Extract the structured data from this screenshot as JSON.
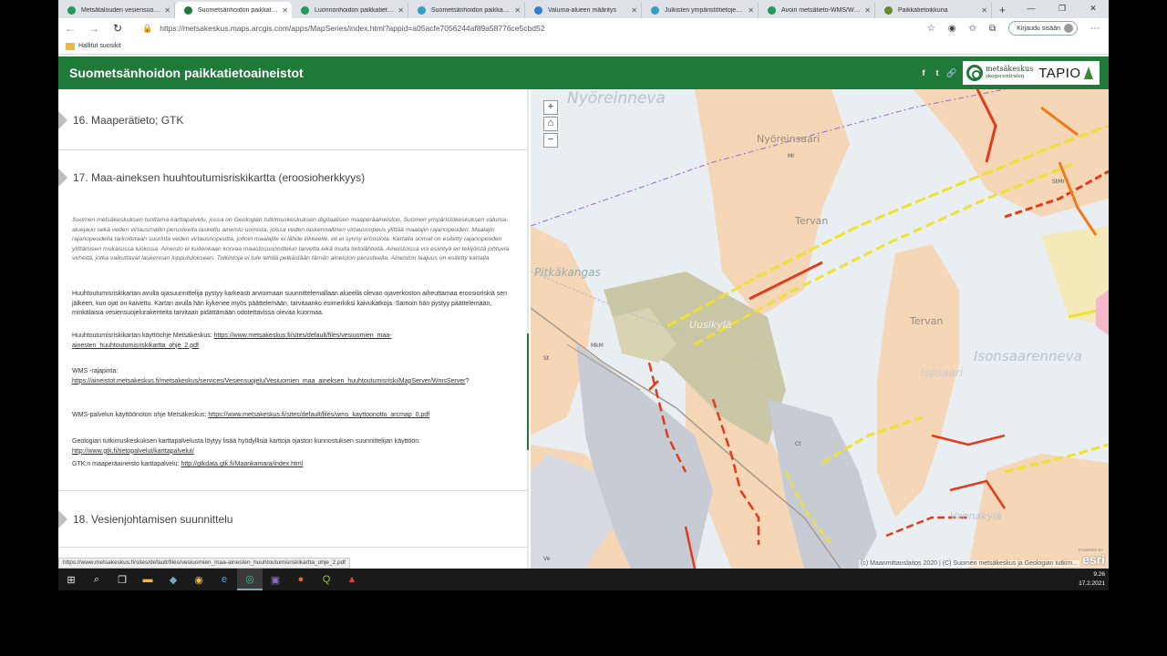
{
  "browser": {
    "tabs": [
      {
        "title": "Metsätalouden vesiensuojelu",
        "color": "#1f9a5a",
        "active": false
      },
      {
        "title": "Suometsänhoidon paikkatietoaineistot",
        "color": "#1f7a3a",
        "active": true
      },
      {
        "title": "Luonnonhoidon paikkatietoaineistot",
        "color": "#1f9a5a",
        "active": false
      },
      {
        "title": "Suometsänhoidon paikkatietoaineistot",
        "color": "#2fa0c0",
        "active": false
      },
      {
        "title": "Valuma-alueen määritys",
        "color": "#2f80d0",
        "active": false
      },
      {
        "title": "Julkisten ympäristötietojen palvelut",
        "color": "#2fa0c0",
        "active": false
      },
      {
        "title": "Avoin metsätieto-WMS/WFS",
        "color": "#1f9a5a",
        "active": false
      },
      {
        "title": "Paikkatietoikkuna",
        "color": "#6a8a2a",
        "active": false
      }
    ],
    "new_tab": "+",
    "window_controls": {
      "minimize": "—",
      "maximize": "❐",
      "close": "✕"
    },
    "url": "https://metsakeskus.maps.arcgis.com/apps/MapSeries/index.html?appid=a05acfe7056244af89a58776ce5cbd52",
    "signin_label": "Kirjaudu sisään",
    "bookmark_folder": "Hallitut suosikit"
  },
  "app": {
    "title": "Suometsänhoidon paikkatietoaineistot",
    "brand_color": "#1f7a3a",
    "social": [
      "f",
      "t",
      "🔗"
    ],
    "logo_metsakeskus": "metsäkeskus",
    "logo_metsakeskus_sub": "skogscentralen",
    "logo_tapio": "TAPIO"
  },
  "panel": {
    "section16": "16. Maaperätieto; GTK",
    "section17": "17. Maa-aineksen huuhtoutumisriskikartta (eroosioherkkyys)",
    "section18": "18. Vesienjohtamisen suunnittelu",
    "intro": "Suomen metsäkeskuksen tuottama karttapalvelu, jossa on Geologian tutkimuskeskuksen digitaalisen maaperäaineiston, Suomen ympäristökeskuksen valuma-aluejaon sekä veden virtausmallin perusteella laskettu aineisto uomista, joissa veden laskennallinen virtausnopeus ylittää maalajin rajanopeuden. Maalajin rajanopeudella tarkoitetaan suurinta veden virtausnopeutta, jolloin maalajite ei lähde liikkeelle, eli ei synny eroosiota. Kartalla uomat on esitetty rajanopeuden ylittämisen mukaisissa luokissa. Aineisto ei kuitenkaan korvaa maastosuunnittelun tarvetta eikä muita tietolähteitä. Aineistoissa voi esiintyä eri tekijöistä johtuvia virheitä, jotka vaikuttavat laskennan lopputulokseen. Tulkintoja ei tule tehdä pelkästään tämän aineiston perusteella. Aineiston laajuus on esitetty kartalla",
    "p1": "Huuhtoutumisriskikartan avulla ojasuunnittelija pystyy karkeasti arvioimaan suunnittelemallaan alueella olevan ojaverkoston aiheuttamaa eroosioriskiä sen jälkeen, kun ojat on kaivettu. Kartan avulla hän kykenee myös päättelemään, tarvitaanko esimerkiksi kaivukatkoja. Samoin hän pystyy päättelemään, minkälaisia vesiensuojelurakenteita tarvitaan pidättämään odotettavissa olevaa kuormaa.",
    "p2_label": "Huuhtoutumisriskikartan käyttöohje Metsäkeskus: ",
    "p2_link": "https://www.metsakeskus.fi/sites/default/files/vesiuomien_maa-ainesten_huuhtoutumisriskikartta_ohje_2.pdf",
    "p3_label": "WMS -rajapinta:",
    "p3_link": "https://aineistot.metsakeskus.fi/metsakeskus/services/Vesiensuojelu/Vesiuomien_maa_aineksen_huuhtoutumisriski/MapServer/WmsServer",
    "p3_suffix": "?",
    "p4_label": "WMS-palvelun käyttöönoton ohje Metsäkeskus: ",
    "p4_link": "https://www.metsakeskus.fi/sites/default/files/wms_kayttoonotto_arcmap_0.pdf",
    "p5_label": "Geologian tutkimuskeskuksen karttapalvelusta löytyy lisää hyödyllisiä karttoja ojaston kunnostuksen suunnittelijan käyttöön:",
    "p5_link": "http://www.gtk.fi/tietopalvelut/karttapalvelut/",
    "p6_label": "GTK:n maaperäaineisto karttapalvelu: ",
    "p6_link": "http://gtkdata.gtk.fi/Maankamara/index.html",
    "status_url": "https://www.metsakeskus.fi/sites/default/files/vesiuomien_maa-ainesten_huuhtoutumisriskikartta_ohje_2.pdf"
  },
  "map": {
    "controls": {
      "zoom_in": "+",
      "home": "⌂",
      "zoom_out": "−"
    },
    "labels": {
      "nyoreinneva": "Nyöreinneva",
      "nyoreinsaari": "Nyöreinsaari",
      "tervan1": "Tervan",
      "tervan2": "Tervan",
      "pitkakangas": "Pitkäkangas",
      "uusikyla": "Uusikylä",
      "isosaari": "Isosaari",
      "isonsaarenneva": "Isonsaarenneva",
      "vannakyla": "Vannakylä",
      "mr": "Mr",
      "st": "St",
      "mkm": "MkM",
      "stmr": "StMr",
      "ve": "Ve",
      "ct": "Ct"
    },
    "attribution": "(c) Maanmittauslaitos 2020 | (C) Suomen metsäkeskus ja Geologian tutkim...",
    "esri": "esri",
    "esri_powered": "POWERED BY"
  },
  "taskbar": {
    "time": "9.26",
    "date": "17.2.2021"
  }
}
